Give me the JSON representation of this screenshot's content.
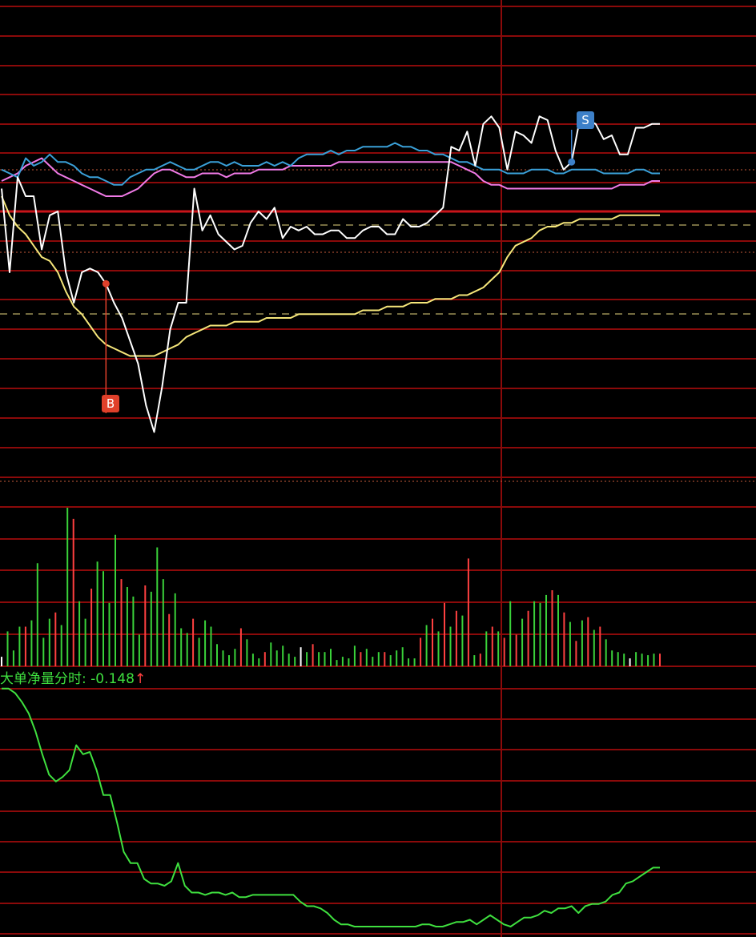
{
  "net_indicator": {
    "label": "大单净量分时: ",
    "value": "-0.148",
    "arrow": "↑"
  },
  "markers": {
    "buy": "B",
    "sell": "S"
  },
  "colors": {
    "background": "#000000",
    "grid": "#8b0a0a",
    "price": "#ffffff",
    "average": "#f5e67a",
    "blue": "#3aa0d8",
    "pink": "#f07ae6",
    "volume_up": "#ff4040",
    "volume_down": "#3ad23a",
    "net": "#3fe03f",
    "marker_buy": "#e0402a",
    "marker_sell": "#3d80c8"
  },
  "chart_data": [
    {
      "type": "line",
      "title": "",
      "xlim": [
        0,
        82
      ],
      "ylim": [
        0,
        100
      ],
      "grid": true,
      "series": [
        {
          "values": [
            82,
            60,
            85,
            80,
            80,
            66,
            75,
            76,
            60,
            52,
            60,
            61,
            60,
            57,
            52,
            48,
            42,
            36,
            25,
            18,
            30,
            45,
            52,
            52,
            82,
            71,
            75,
            70,
            68,
            66,
            67,
            73,
            76,
            74,
            77,
            69,
            72,
            71,
            72,
            70,
            70,
            71,
            71,
            69,
            69,
            71,
            72,
            72,
            70,
            70,
            74,
            72,
            72,
            73,
            75,
            77,
            93,
            92,
            97,
            88,
            99,
            101,
            98,
            87,
            97,
            96,
            94,
            101,
            100,
            92,
            87,
            89,
            100,
            100,
            99,
            95,
            96,
            91,
            91,
            98,
            98,
            99,
            99
          ]
        },
        {
          "values": [
            80,
            75,
            72,
            70,
            67,
            64,
            63,
            60,
            55,
            51,
            49,
            46,
            43,
            41,
            40,
            39,
            38,
            38,
            38,
            38,
            39,
            40,
            41,
            43,
            44,
            45,
            46,
            46,
            46,
            47,
            47,
            47,
            47,
            48,
            48,
            48,
            48,
            49,
            49,
            49,
            49,
            49,
            49,
            49,
            49,
            50,
            50,
            50,
            51,
            51,
            51,
            52,
            52,
            52,
            53,
            53,
            53,
            54,
            54,
            55,
            56,
            58,
            60,
            64,
            67,
            68,
            69,
            71,
            72,
            72,
            73,
            73,
            74,
            74,
            74,
            74,
            74,
            75,
            75,
            75,
            75,
            75,
            75
          ]
        },
        {
          "values": [
            87,
            86,
            85,
            90,
            88,
            89,
            91,
            89,
            89,
            88,
            86,
            85,
            85,
            84,
            83,
            83,
            85,
            86,
            87,
            87,
            88,
            89,
            88,
            87,
            87,
            88,
            89,
            89,
            88,
            89,
            88,
            88,
            88,
            89,
            88,
            89,
            88,
            90,
            91,
            91,
            91,
            92,
            91,
            92,
            92,
            93,
            93,
            93,
            93,
            94,
            93,
            93,
            92,
            92,
            91,
            91,
            90,
            89,
            89,
            88,
            87,
            87,
            87,
            86,
            86,
            86,
            87,
            87,
            87,
            86,
            86,
            87,
            87,
            87,
            87,
            86,
            86,
            86,
            86,
            87,
            87,
            86,
            86
          ]
        },
        {
          "values": [
            84,
            85,
            86,
            88,
            89,
            90,
            88,
            86,
            85,
            84,
            83,
            82,
            81,
            80,
            80,
            80,
            81,
            82,
            84,
            86,
            87,
            87,
            86,
            85,
            85,
            86,
            86,
            86,
            85,
            86,
            86,
            86,
            87,
            87,
            87,
            87,
            88,
            88,
            88,
            88,
            88,
            88,
            89,
            89,
            89,
            89,
            89,
            89,
            89,
            89,
            89,
            89,
            89,
            89,
            89,
            89,
            89,
            88,
            87,
            86,
            84,
            83,
            83,
            82,
            82,
            82,
            82,
            82,
            82,
            82,
            82,
            82,
            82,
            82,
            82,
            82,
            82,
            83,
            83,
            83,
            83,
            84,
            84
          ]
        }
      ]
    },
    {
      "type": "bar",
      "title": "",
      "ylim": [
        0,
        200
      ],
      "values": [
        12,
        44,
        20,
        50,
        50,
        58,
        130,
        36,
        60,
        68,
        52,
        200,
        186,
        82,
        60,
        98,
        132,
        120,
        80,
        166,
        110,
        100,
        88,
        40,
        102,
        94,
        150,
        110,
        66,
        92,
        48,
        42,
        60,
        36,
        58,
        50,
        28,
        20,
        14,
        22,
        48,
        34,
        16,
        10,
        18,
        30,
        20,
        26,
        16,
        12,
        24,
        18,
        28,
        18,
        18,
        22,
        8,
        12,
        10,
        26,
        18,
        22,
        12,
        18,
        18,
        14,
        20,
        24,
        10,
        10,
        36,
        52,
        60,
        44,
        80,
        50,
        70,
        64,
        136,
        14,
        16,
        44,
        50,
        44,
        36,
        82,
        40,
        60,
        70,
        82,
        80,
        90,
        96,
        90,
        68,
        56,
        32,
        58,
        62,
        46,
        50,
        34,
        20,
        18,
        16,
        10,
        18,
        16,
        14,
        16,
        16
      ]
    },
    {
      "type": "line",
      "title": "",
      "ylim": [
        0,
        100
      ],
      "values": [
        99,
        99,
        97,
        93,
        88,
        80,
        70,
        61,
        58,
        60,
        63,
        74,
        70,
        71,
        63,
        52,
        52,
        40,
        27,
        22,
        22,
        15,
        13,
        13,
        12,
        14,
        22,
        12,
        9,
        9,
        8,
        9,
        9,
        8,
        9,
        7,
        7,
        8,
        8,
        8,
        8,
        8,
        8,
        8,
        5,
        3,
        3,
        2,
        0,
        -3,
        -5,
        -5,
        -6,
        -6,
        -6,
        -6,
        -6,
        -6,
        -6,
        -6,
        -6,
        -6,
        -5,
        -5,
        -6,
        -6,
        -5,
        -4,
        -4,
        -3,
        -5,
        -3,
        -1,
        -3,
        -5,
        -6,
        -4,
        -2,
        -2,
        -1,
        1,
        0,
        2,
        2,
        3,
        0,
        3,
        4,
        4,
        5,
        8,
        9,
        13,
        14,
        16,
        18,
        20,
        20
      ]
    }
  ]
}
